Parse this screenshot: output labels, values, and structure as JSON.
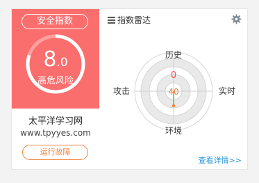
{
  "left": {
    "badge_label": "安全指数",
    "score_int": "8",
    "score_dec": ".0",
    "risk_label": "高危风险",
    "site_name": "太平洋学习网",
    "site_url": "www.tpyyes.com",
    "run_button": "运行故障",
    "gauge_progress": 0.8,
    "accent_color": "#fa6e6e"
  },
  "right": {
    "title": "指数雷达",
    "menu_icon": "hamburger-icon",
    "settings_icon": "gear-icon",
    "radar": {
      "axis_top": "历史",
      "axis_right": "实时",
      "axis_bottom": "环境",
      "axis_left": "攻击",
      "value_top": "0",
      "value_center": "40"
    },
    "view_more": "查看详情>>"
  }
}
